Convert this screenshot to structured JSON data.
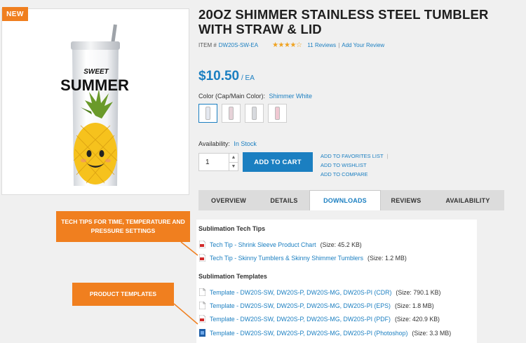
{
  "product": {
    "badge": "NEW",
    "title": "20OZ SHIMMER STAINLESS STEEL TUMBLER WITH STRAW & LID",
    "item_label": "ITEM #",
    "item_number": "DW20S-SW-EA",
    "rating": 4,
    "rating_max": 5,
    "reviews_text": "11 Reviews",
    "add_review_text": "Add Your Review",
    "price": "$10.50",
    "price_unit": "/ EA",
    "color_label": "Color (Cap/Main Color):",
    "color_value": "Shimmer White",
    "swatches": [
      {
        "name": "Shimmer White",
        "color": "#e4e8f0"
      },
      {
        "name": "Shimmer Pink",
        "color": "#e6d2d8"
      },
      {
        "name": "Shimmer Silver",
        "color": "#d8dade"
      },
      {
        "name": "Shimmer Blush",
        "color": "#f0c8d2"
      }
    ],
    "availability_label": "Availability:",
    "availability_value": "In Stock",
    "quantity": "1",
    "add_to_cart": "ADD TO CART",
    "favorites": "ADD TO FAVORITES LIST",
    "wishlist": "ADD TO WISHLIST",
    "compare": "ADD TO COMPARE",
    "image_text": {
      "line1": "SWEET",
      "line2": "SUMMER"
    }
  },
  "tabs": [
    {
      "label": "OVERVIEW",
      "active": false
    },
    {
      "label": "DETAILS",
      "active": false
    },
    {
      "label": "DOWNLOADS",
      "active": true
    },
    {
      "label": "REVIEWS",
      "active": false
    },
    {
      "label": "AVAILABILITY",
      "active": false
    }
  ],
  "downloads": {
    "tech_tips_heading": "Sublimation Tech Tips",
    "tech_tips": [
      {
        "label": "Tech Tip - Shrink Sleeve Product Chart",
        "size": "(Size: 45.2 KB)",
        "icon": "pdf-icon"
      },
      {
        "label": "Tech Tip - Skinny Tumblers & Skinny Shimmer Tumblers",
        "size": "(Size: 1.2 MB)",
        "icon": "pdf-icon"
      }
    ],
    "templates_heading": "Sublimation Templates",
    "templates": [
      {
        "label": "Template - DW20S-SW, DW20S-P, DW20S-MG, DW20S-PI (CDR)",
        "size": "(Size: 790.1 KB)",
        "icon": "file-icon"
      },
      {
        "label": "Template - DW20S-SW, DW20S-P, DW20S-MG, DW20S-PI (EPS)",
        "size": "(Size: 1.8 MB)",
        "icon": "file-icon"
      },
      {
        "label": "Template - DW20S-SW, DW20S-P, DW20S-MG, DW20S-PI (PDF)",
        "size": "(Size: 420.9 KB)",
        "icon": "pdf-icon"
      },
      {
        "label": "Template - DW20S-SW, DW20S-P, DW20S-MG, DW20S-PI (Photoshop)",
        "size": "(Size: 3.3 MB)",
        "icon": "photoshop-icon"
      }
    ]
  },
  "callouts": {
    "tech_tips": "TECH TIPS FOR TIME, TEMPERATURE AND PRESSURE SETTINGS",
    "templates": "PRODUCT TEMPLATES"
  },
  "colors": {
    "accent": "#1b7fc1",
    "callout": "#f07f1f",
    "star": "#f0a21f"
  }
}
